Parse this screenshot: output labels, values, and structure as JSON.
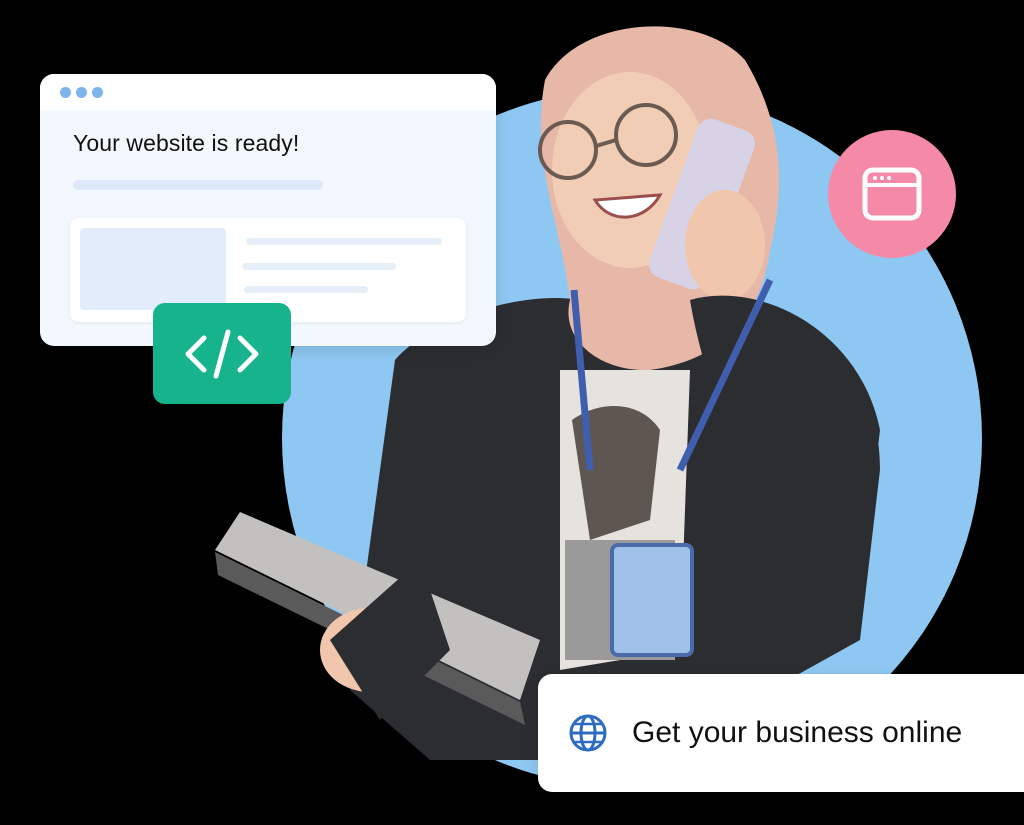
{
  "browser_card": {
    "title": "Your website is ready!"
  },
  "cta": {
    "label": "Get your business online",
    "icon": "globe-icon"
  },
  "badges": {
    "code_icon": "code-icon",
    "window_icon": "browser-window-icon"
  },
  "colors": {
    "circle": "#8ec8f2",
    "code_badge": "#16b38c",
    "window_badge": "#f58aa8",
    "globe": "#2d6cc0"
  }
}
